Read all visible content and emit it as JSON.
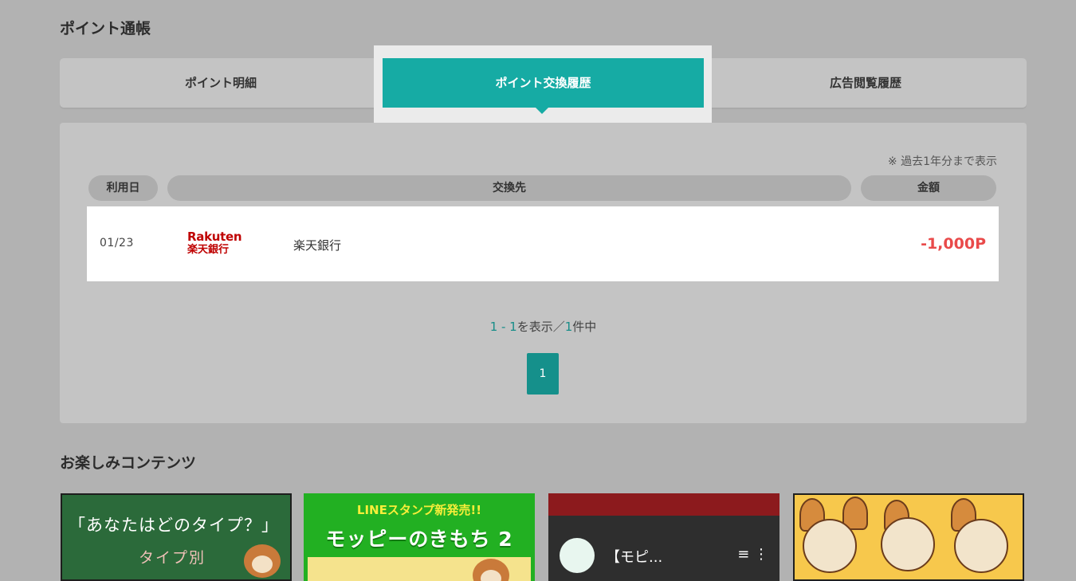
{
  "sections": {
    "passbook_title": "ポイント通帳",
    "fun_title": "お楽しみコンテンツ"
  },
  "tabs": [
    {
      "label": "ポイント明細",
      "active": false
    },
    {
      "label": "ポイント交換履歴",
      "active": true
    },
    {
      "label": "広告閲覧履歴",
      "active": false
    }
  ],
  "table": {
    "note": "※ 過去1年分まで表示",
    "headers": {
      "date": "利用日",
      "destination": "交換先",
      "amount": "金額"
    },
    "rows": [
      {
        "date": "01/23",
        "logo_top": "Rakuten",
        "logo_bottom": "楽天銀行",
        "destination": "楽天銀行",
        "amount": "-1,000P"
      }
    ]
  },
  "pagination": {
    "range": "1 - 1",
    "range_suffix": "を表示／",
    "total": "1",
    "total_suffix": "件中",
    "current_page": "1"
  },
  "cards": [
    {
      "heading": "「あなたはどのタイプ？」",
      "sub": "タイプ別"
    },
    {
      "top": "LINEスタンプ新発売!!",
      "main": "モッピーのきもち 2"
    },
    {
      "title": "【モピ...",
      "menu": "≡ ⋮"
    },
    {
      "alt": ""
    }
  ],
  "colors": {
    "accent": "#16aba4",
    "negative_amount": "#e94a4a",
    "rakuten_red": "#bf0000"
  }
}
